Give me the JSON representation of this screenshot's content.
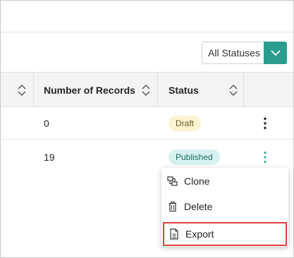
{
  "filter": {
    "selected": "All Statuses"
  },
  "table": {
    "headers": {
      "records": "Number of Records",
      "status": "Status"
    },
    "rows": [
      {
        "records": "0",
        "status": "Draft"
      },
      {
        "records": "19",
        "status": "Published"
      }
    ]
  },
  "menu": {
    "items": [
      {
        "label": "Clone",
        "icon": "clone-icon"
      },
      {
        "label": "Delete",
        "icon": "trash-icon"
      },
      {
        "label": "Export",
        "icon": "document-icon"
      }
    ],
    "highlighted": "Export"
  },
  "colors": {
    "accent": "#2a9d8f",
    "highlight_border": "#e0403c",
    "draft_badge": "#fdf3d0",
    "published_badge": "#d7f1ee"
  }
}
